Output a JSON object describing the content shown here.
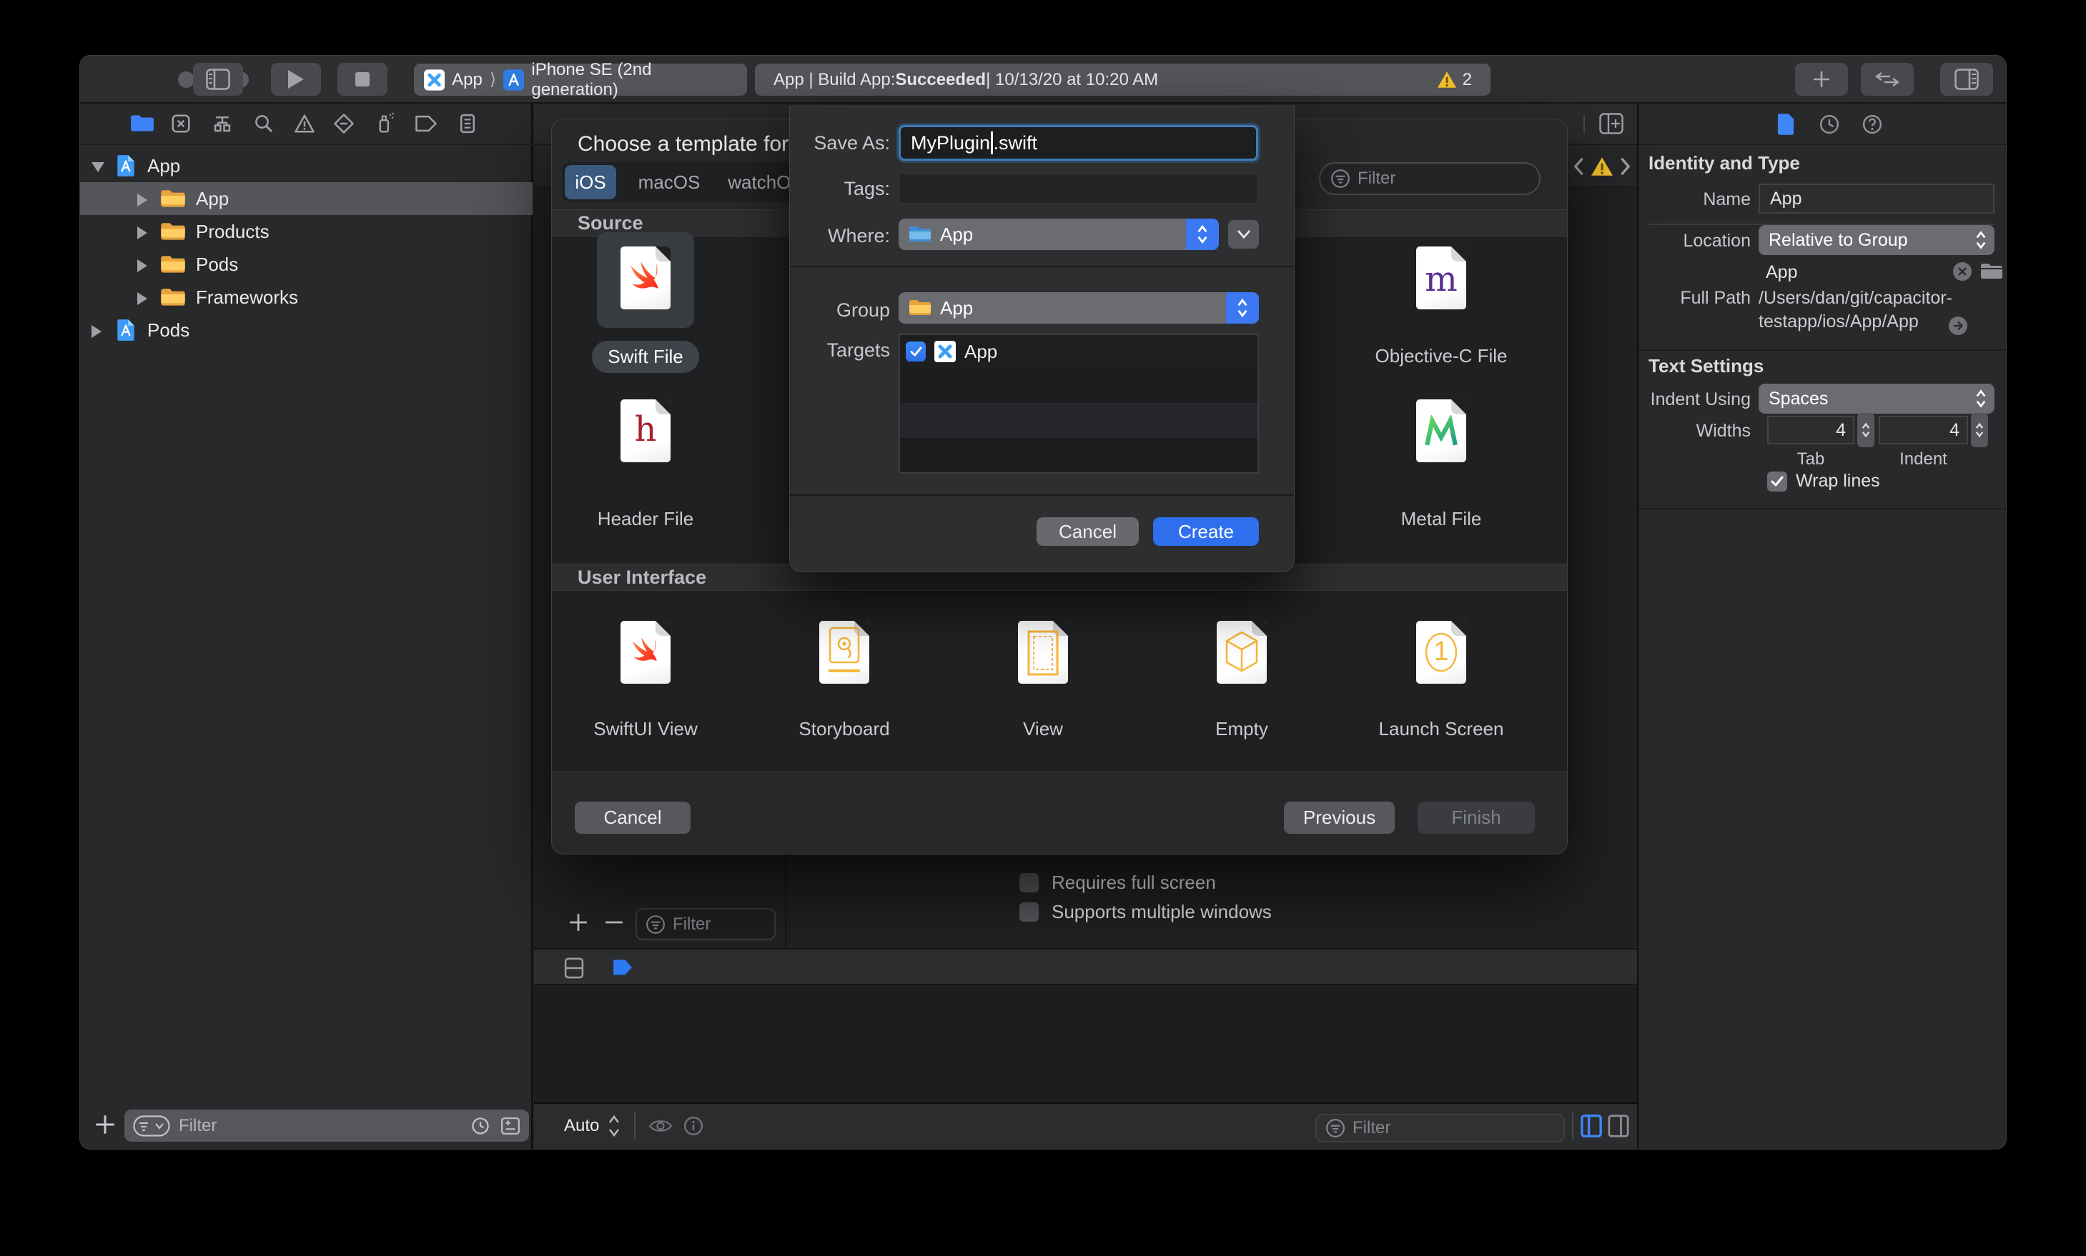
{
  "colors": {
    "accent_blue": "#3b78f2",
    "tab_selected_blue": "#3c5a7e",
    "warning_yellow": "#f6c32f",
    "folder_yellow": "#f7b836",
    "create_blue": "#2f6fed"
  },
  "toolbar": {
    "scheme_project": "App",
    "scheme_separator": "⟩",
    "scheme_destination": "iPhone SE (2nd generation)",
    "status_prefix": "App | Build App: ",
    "status_bold": "Succeeded",
    "status_suffix": " | 10/13/20 at 10:20 AM",
    "warning_count": "2"
  },
  "navigator": {
    "items": [
      {
        "label": "App"
      },
      {
        "label": "App"
      },
      {
        "label": "Products"
      },
      {
        "label": "Pods"
      },
      {
        "label": "Frameworks"
      },
      {
        "label": "Pods"
      }
    ],
    "filter_placeholder": "Filter"
  },
  "dialog": {
    "title": "Choose a template for your",
    "tabs": [
      {
        "label": "iOS"
      },
      {
        "label": "macOS"
      },
      {
        "label": "watchOS"
      }
    ],
    "filter_placeholder": "Filter",
    "source_section": "Source",
    "ui_section": "User Interface",
    "templates": {
      "swift": {
        "label": "Swift File"
      },
      "objc": {
        "label": "Objective-C File",
        "glyph": "m"
      },
      "header": {
        "label": "Header File",
        "glyph": "h"
      },
      "metal": {
        "label": "Metal File"
      },
      "swiftui": {
        "label": "SwiftUI View"
      },
      "storyboard": {
        "label": "Storyboard"
      },
      "view": {
        "label": "View"
      },
      "empty": {
        "label": "Empty"
      },
      "launch": {
        "label": "Launch Screen",
        "glyph": "1"
      }
    },
    "cancel": "Cancel",
    "previous": "Previous",
    "finish": "Finish"
  },
  "sheet": {
    "save_as_label": "Save As:",
    "filename": "MyPlugin",
    "extension": ".swift",
    "tags_label": "Tags:",
    "where_label": "Where:",
    "where_value": "App",
    "group_label": "Group",
    "group_value": "App",
    "targets_label": "Targets",
    "target_name": "App",
    "cancel": "Cancel",
    "create": "Create"
  },
  "editor": {
    "checkbox1": "Requires full screen",
    "checkbox2": "Supports multiple windows",
    "filter_placeholder": "Filter",
    "auto_label": "Auto",
    "bottom_filter_placeholder": "Filter"
  },
  "inspector": {
    "identity_section": "Identity and Type",
    "name_label": "Name",
    "name_value": "App",
    "location_label": "Location",
    "location_value": "Relative to Group",
    "location_file": "App",
    "fullpath_label": "Full Path",
    "fullpath_line1": "/Users/dan/git/capacitor-",
    "fullpath_line2": "testapp/ios/App/App",
    "text_section": "Text Settings",
    "indent_label": "Indent Using",
    "indent_value": "Spaces",
    "widths_label": "Widths",
    "tab_width": "4",
    "indent_width": "4",
    "tab_caption": "Tab",
    "indent_caption": "Indent",
    "wrap_label": "Wrap lines"
  }
}
